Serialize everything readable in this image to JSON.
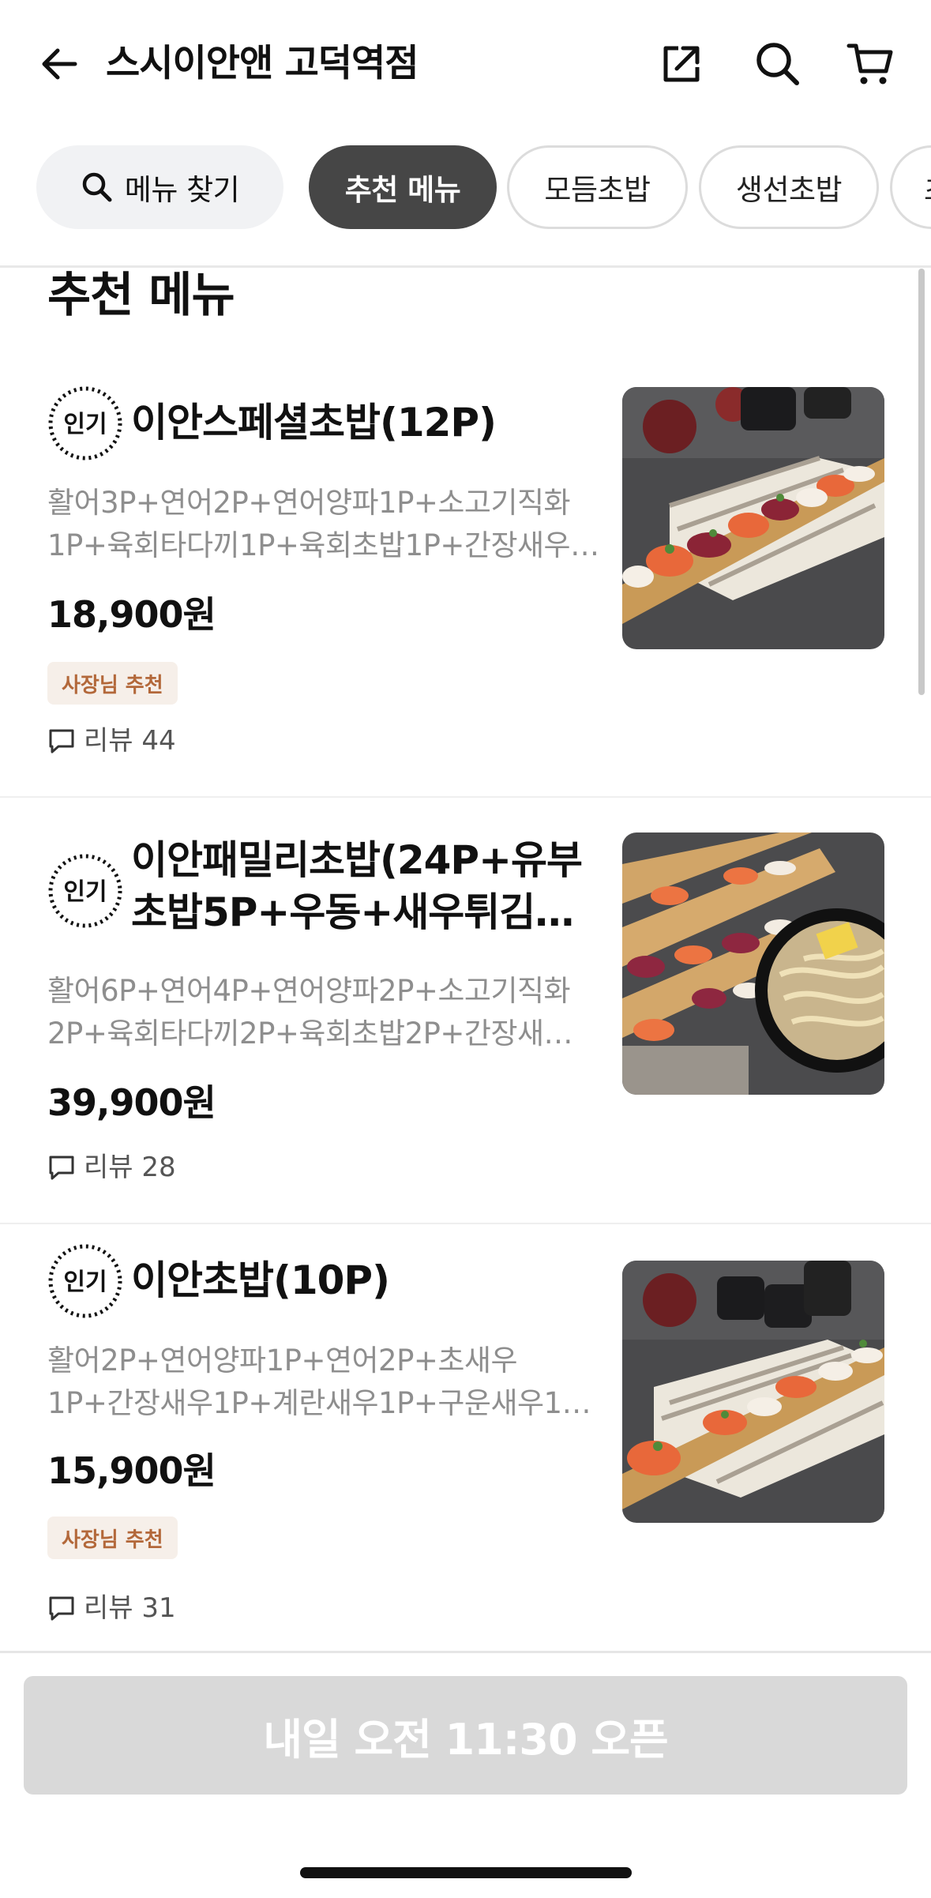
{
  "header": {
    "title": "스시이안앤 고덕역점",
    "icons": [
      "arrow-left-icon",
      "share-icon",
      "search-icon",
      "cart-icon"
    ]
  },
  "chips": {
    "search_label": "메뉴 찾기",
    "items": [
      "추천 메뉴",
      "모듬초밥",
      "생선초밥",
      "초"
    ],
    "active": "추천 메뉴"
  },
  "section": {
    "title": "추천 메뉴"
  },
  "menu": [
    {
      "badge": "인기",
      "name": "이안스페셜초밥(12P)",
      "desc": "활어3P+연어2P+연어양파1P+소고기직화1P+육회타다끼1P+육회초밥1P+간장새우…",
      "price": "18,900원",
      "tag": "사장님 추천",
      "review": "리뷰 44"
    },
    {
      "badge": "인기",
      "name": "이안패밀리초밥(24P+유부초밥5P+우동+새우튀김…",
      "desc": "활어6P+연어4P+연어양파2P+소고기직화2P+육회타다끼2P+육회초밥2P+간장새…",
      "price": "39,900원",
      "tag": "",
      "review": "리뷰 28"
    },
    {
      "badge": "인기",
      "name": "이안초밥(10P)",
      "desc": "활어2P+연어양파1P+연어2P+초새우1P+간장새우1P+계란새우1P+구운새우1…",
      "price": "15,900원",
      "tag": "사장님 추천",
      "review": "리뷰 31"
    }
  ],
  "footer": {
    "button_label": "내일 오전 11:30 오픈"
  },
  "colors": {
    "active_chip": "#464646",
    "owner_tag_bg": "#f6efe9",
    "owner_tag_text": "#b3683a",
    "disabled_button": "#d9d9d9"
  }
}
